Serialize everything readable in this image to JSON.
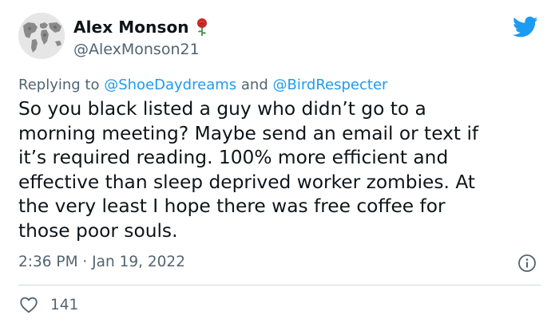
{
  "author": {
    "display_name": "Alex Monson",
    "handle": "@AlexMonson21",
    "name_emoji": "rose-icon",
    "avatar": "world-map-avatar"
  },
  "platform_icon": "twitter-bird-icon",
  "reply": {
    "prefix": "Replying to",
    "mention_1": "@ShoeDaydreams",
    "joiner": "and",
    "mention_2": "@BirdRespecter"
  },
  "body": "So you black listed a guy who didn’t go to a\nmorning meeting? Maybe send an email or text if\nit’s required reading. 100% more efficient and\neffective than sleep deprived worker zombies. At\nthe very least I hope there was free coffee for\nthose poor souls.",
  "timestamp": "2:36 PM · Jan 19, 2022",
  "info_icon": "info-icon",
  "likes": {
    "icon": "heart-icon",
    "count": "141"
  },
  "colors": {
    "text": "#0f1419",
    "secondary": "#536471",
    "link": "#1d9bf0",
    "divider": "#cfd9de"
  }
}
